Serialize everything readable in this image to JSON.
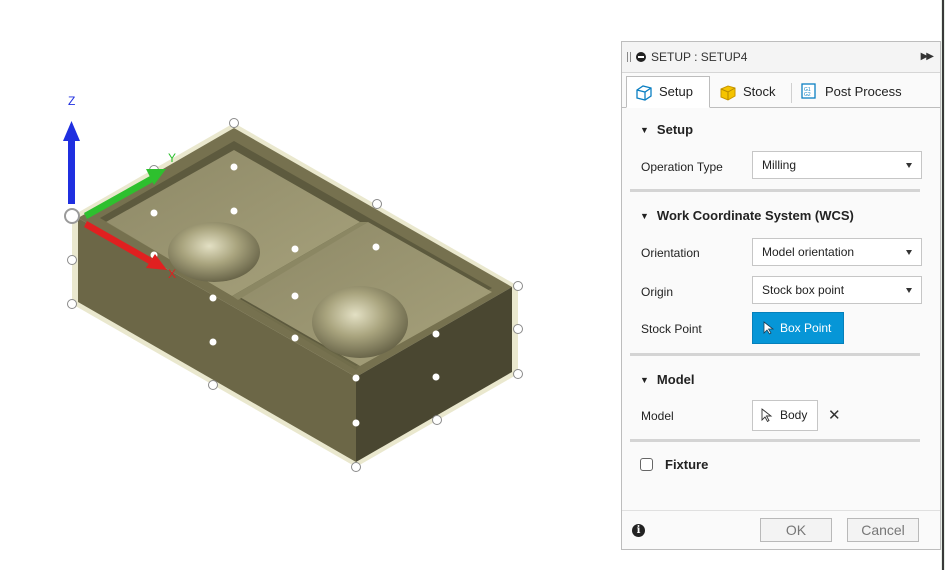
{
  "viewport": {
    "axes": {
      "x_label": "X",
      "y_label": "Y",
      "z_label": "Z"
    }
  },
  "panel": {
    "title": "SETUP : SETUP4",
    "tabs": [
      {
        "label": "Setup",
        "icon": "setup-tab-icon",
        "active": true
      },
      {
        "label": "Stock",
        "icon": "stock-tab-icon",
        "active": false
      },
      {
        "label": "Post Process",
        "icon": "post-process-tab-icon",
        "active": false
      }
    ],
    "setup_section": {
      "header": "Setup",
      "operation_type": {
        "label": "Operation Type",
        "value": "Milling"
      }
    },
    "wcs_section": {
      "header": "Work Coordinate System (WCS)",
      "orientation": {
        "label": "Orientation",
        "value": "Model orientation"
      },
      "origin": {
        "label": "Origin",
        "value": "Stock box point"
      },
      "stock_point": {
        "label": "Stock Point",
        "button": "Box Point"
      }
    },
    "model_section": {
      "header": "Model",
      "model": {
        "label": "Model",
        "button": "Body"
      }
    },
    "fixture": {
      "label": "Fixture",
      "checked": false
    },
    "footer": {
      "ok": "OK",
      "cancel": "Cancel"
    }
  },
  "colors": {
    "accent_blue": "#0696d7",
    "axis_x": "#e02020",
    "axis_y": "#2ec02e",
    "axis_z": "#1f2fe0",
    "model_olive": "#6f6a4e"
  }
}
